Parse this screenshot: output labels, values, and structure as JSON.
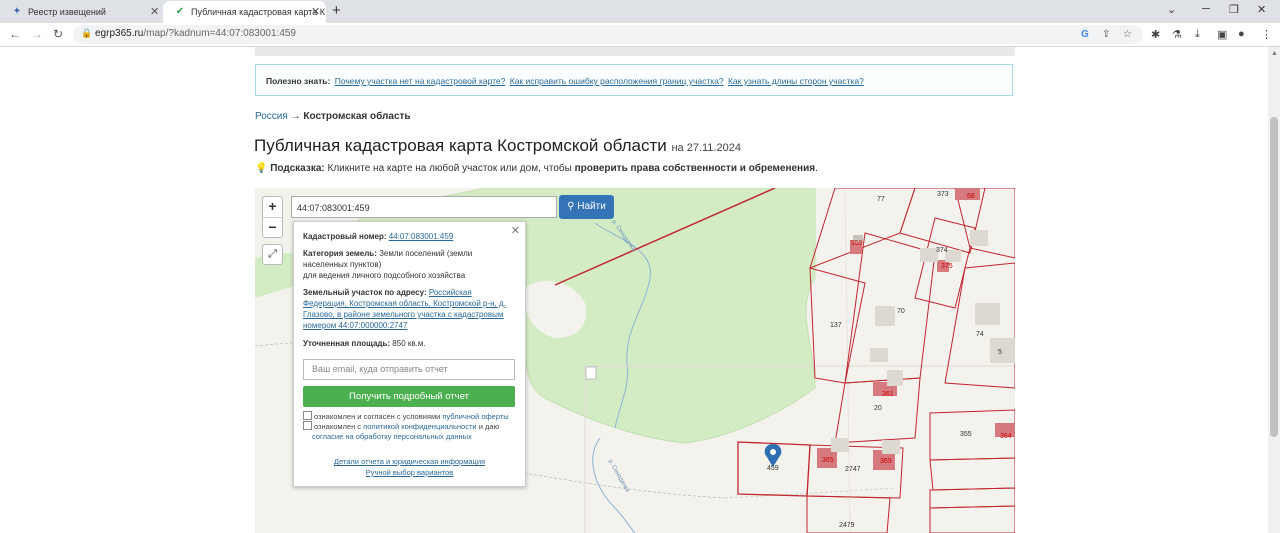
{
  "browser": {
    "tabs": [
      {
        "title": "Реестр извещений",
        "active": false
      },
      {
        "title": "Публичная кадастровая карта К",
        "active": true
      }
    ],
    "new_tab_symbol": "+",
    "url_host": "egrp365.ru",
    "url_path": "/map/?kadnum=44:07:083001:459"
  },
  "infobox": {
    "label": "Полезно знать:",
    "links": [
      "Почему участка нет на кадастровой карте?",
      "Как исправить ошибку расположения границ участка?",
      "Как узнать длины сторон участка?"
    ]
  },
  "breadcrumbs": {
    "root": "Россия",
    "sep": "→",
    "current": "Костромская область"
  },
  "page": {
    "title": "Публичная кадастровая карта Костромской области",
    "date": "на 27.11.2024",
    "hint_label": "Подсказка:",
    "hint_text": "Кликните на карте на любой участок или дом, чтобы",
    "hint_bold": "проверить права собственности и обременения",
    "hint_end": "."
  },
  "map": {
    "zoom_in": "+",
    "zoom_out": "−",
    "search_value": "44:07:083001:459",
    "find_label": "Найти",
    "stream_label": "р. Сенодачка",
    "plot_labels": {
      "p77": "77",
      "p373": "373",
      "p374": "374",
      "p70": "70",
      "p137": "137",
      "p74": "74",
      "p5": "5",
      "p20": "20",
      "p355": "355",
      "p459": "459",
      "p2747": "2747",
      "p2479": "2479",
      "p361": "361",
      "p365": "365",
      "p369": "369",
      "p375": "375",
      "p359": "359",
      "p364": "364",
      "p68": "68"
    }
  },
  "popup": {
    "cad_label": "Кадастровый номер:",
    "cad_value": "44:07:083001:459",
    "category_label": "Категория земель:",
    "category_value": "Земли поселений (земли населенных пунктов)",
    "usage": "для ведения личного подсобного хозяйства",
    "address_label": "Земельный участок по адресу:",
    "address_value": "Российская Федерация, Костромская область, Костромской р-н, д. Глазово, в районе земельного участка с кадастровым номером 44:07:000000:2747",
    "area_label": "Уточненная площадь:",
    "area_value": "850 кв.м.",
    "email_placeholder": "Ваш email, куда отправить отчет",
    "get_report": "Получить подробный отчет",
    "agree1_text": "ознакомлен и согласен с условиями",
    "agree1_link": "публичной оферты",
    "agree2_text": "ознакомлен с",
    "agree2_link": "политикой конфиденциальности",
    "agree2_mid": "и даю",
    "agree2_link2": "согласие на обработку персональных данных",
    "footer_link1": "Детали отчета и юридическая информация",
    "footer_link2": "Ручной выбор вариантов"
  }
}
